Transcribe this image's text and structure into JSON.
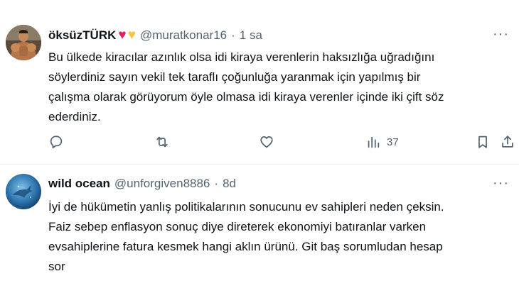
{
  "tweets": [
    {
      "author": {
        "name": "öksüzTÜRK",
        "handle": "@muratkonar16",
        "emoji": [
          "red-heart",
          "yellow-heart"
        ]
      },
      "separator": "·",
      "time": "1 sa",
      "text": "Bu ülkede kiracılar azınlık olsa idi kiraya verenlerin haksızlığa uğradığını\nsöylerdiniz  sayın vekil tek taraflı çoğunluğa yaranmak için yapılmış bir\nçalışma olarak görüyorum  öyle olmasa idi kiraya verenler içinde iki çift söz\nederdiniz.",
      "more_icon": "ellipsis-icon",
      "actions": {
        "reply_count": "",
        "retweet_count": "",
        "like_count": "",
        "view_count": "37"
      }
    },
    {
      "author": {
        "name": "wild ocean",
        "handle": "@unforgiven8886"
      },
      "separator": "·",
      "time": "8d",
      "text": "İyi de hükümetin yanlış politikalarının sonucunu ev sahipleri neden çeksin.\nFaiz sebep enflasyon sonuç diye direterek ekonomiyi batıranlar varken\nevsahiplerine fatura kesmek hangi aklın ürünü.  Git baş sorumludan hesap\nsor",
      "more_icon": "ellipsis-icon"
    }
  ],
  "colors": {
    "text": "#0f1419",
    "secondary": "#536471",
    "divider": "#eff3f4",
    "red_heart": "#e0245e",
    "yellow_heart": "#f4c542"
  }
}
